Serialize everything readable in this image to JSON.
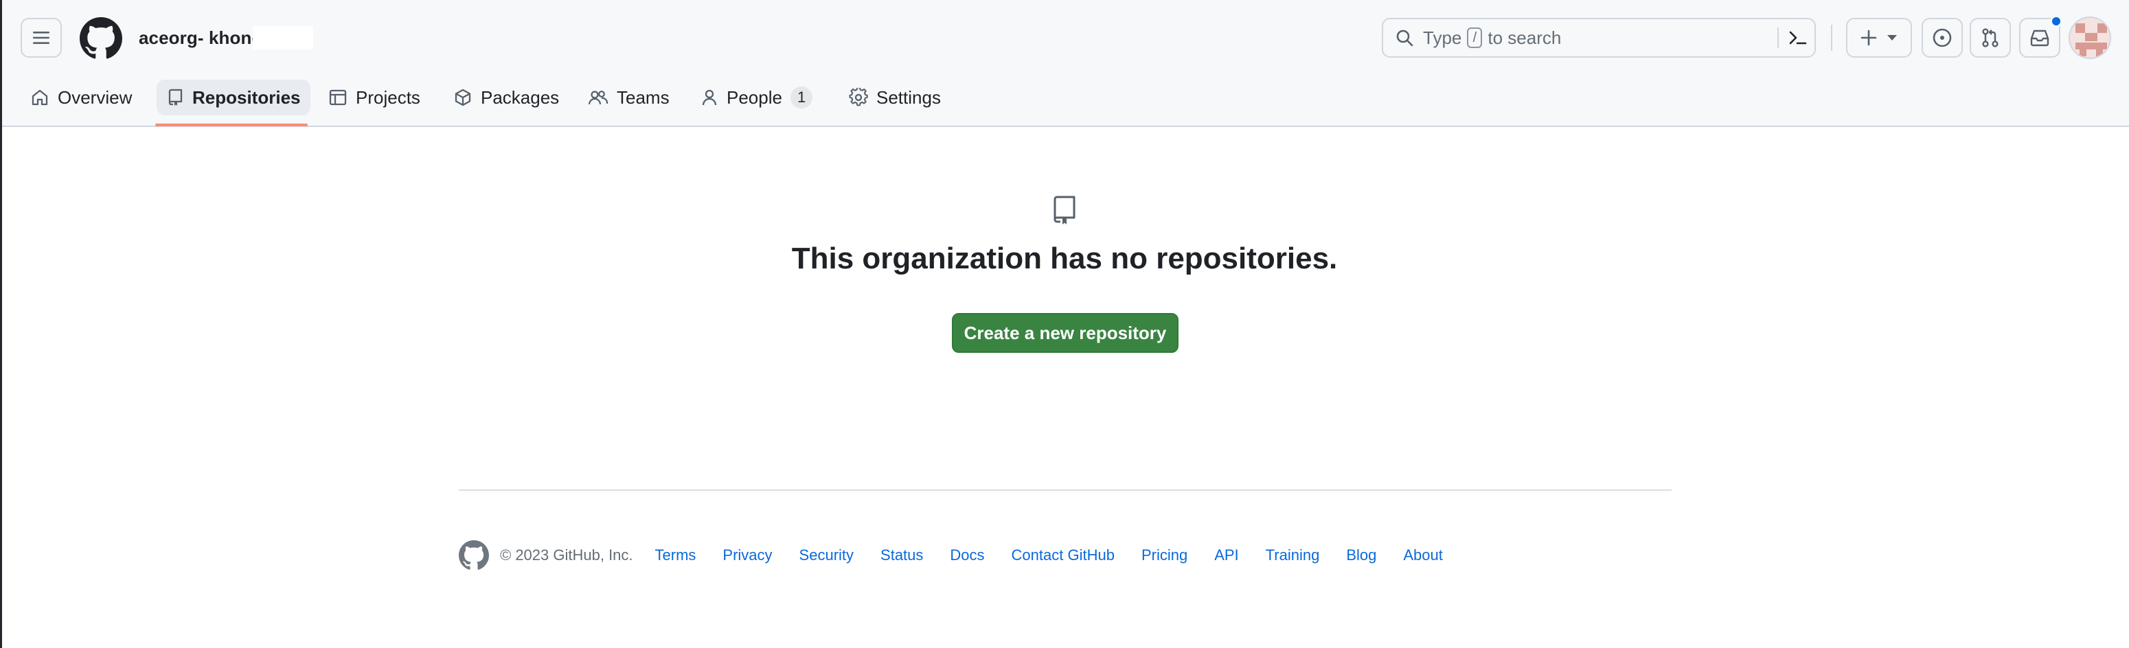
{
  "header": {
    "org_name": "aceorg- khongks",
    "search_prefix": "Type",
    "search_key": "/",
    "search_suffix": "to search"
  },
  "nav": {
    "items": [
      {
        "label": "Overview",
        "icon": "home-icon"
      },
      {
        "label": "Repositories",
        "icon": "repo-icon",
        "active": true
      },
      {
        "label": "Projects",
        "icon": "table-icon"
      },
      {
        "label": "Packages",
        "icon": "package-icon"
      },
      {
        "label": "Teams",
        "icon": "people-icon"
      },
      {
        "label": "People",
        "icon": "person-icon",
        "count": "1"
      },
      {
        "label": "Settings",
        "icon": "gear-icon"
      }
    ]
  },
  "main": {
    "empty_title": "This organization has no repositories.",
    "create_button": "Create a new repository"
  },
  "footer": {
    "copyright": "© 2023 GitHub, Inc.",
    "links": [
      "Terms",
      "Privacy",
      "Security",
      "Status",
      "Docs",
      "Contact GitHub",
      "Pricing",
      "API",
      "Training",
      "Blog",
      "About"
    ]
  },
  "colors": {
    "accent_underline": "#fd8c73",
    "primary_button": "#3a8442",
    "link": "#0969da",
    "notification_dot": "#0969da"
  }
}
